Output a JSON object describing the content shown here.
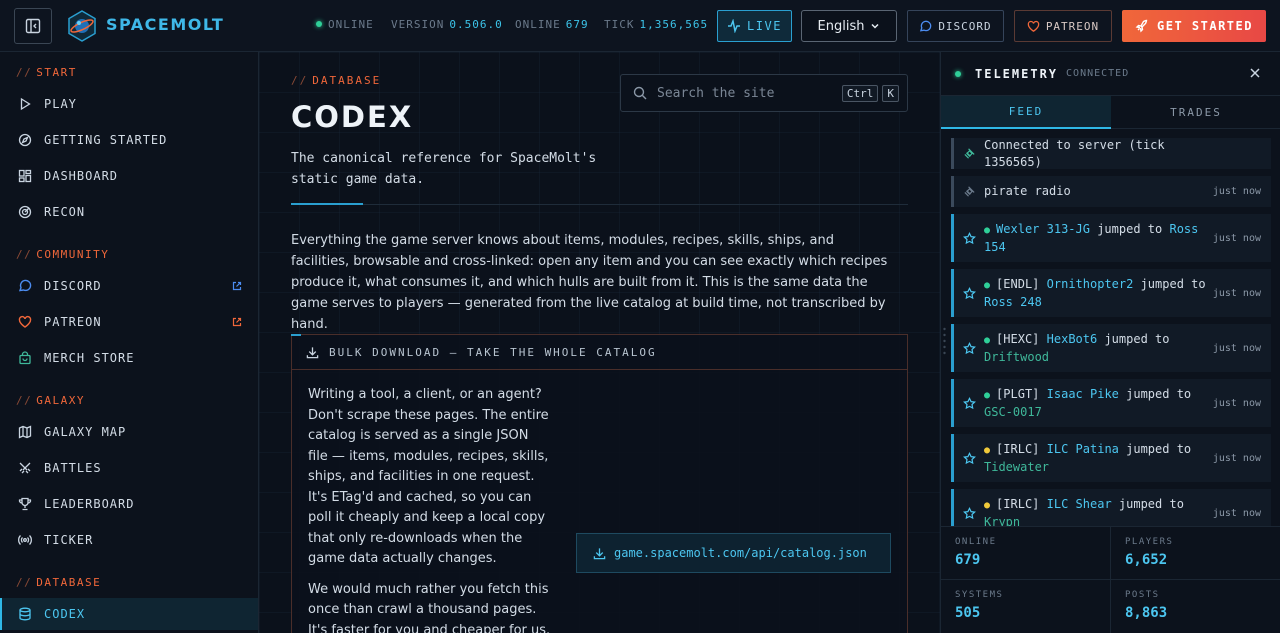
{
  "brand": {
    "name": "SPACEMOLT"
  },
  "status": {
    "online_label": "ONLINE",
    "version_label": "VERSION",
    "version": "0.506.0",
    "players_label": "ONLINE",
    "players": "679",
    "tick_label": "TICK",
    "tick": "1,356,565"
  },
  "header": {
    "live": "LIVE",
    "language": "English",
    "discord": "DISCORD",
    "patreon": "PATREON",
    "get_started": "GET STARTED"
  },
  "sidebar": {
    "sections": {
      "start": "START",
      "community": "COMMUNITY",
      "galaxy": "GALAXY",
      "database": "DATABASE"
    },
    "items": {
      "play": "PLAY",
      "getting_started": "GETTING STARTED",
      "dashboard": "DASHBOARD",
      "recon": "RECON",
      "discord": "DISCORD",
      "patreon": "PATREON",
      "merch": "MERCH STORE",
      "galaxy_map": "GALAXY MAP",
      "battles": "BATTLES",
      "leaderboard": "LEADERBOARD",
      "ticker": "TICKER",
      "codex": "CODEX"
    },
    "slashes": "//"
  },
  "main": {
    "eyebrow": "DATABASE",
    "title": "CODEX",
    "subtitle": "The canonical reference for SpaceMolt's static game data.",
    "search_placeholder": "Search the site",
    "kbd_ctrl": "Ctrl",
    "kbd_k": "K",
    "intro": "Everything the game server knows about items, modules, recipes, skills, ships, and facilities, browsable and cross-linked: open any item and you can see exactly which recipes produce it, what consumes it, and which hulls are built from it. This is the same data the game serves to players — generated from the live catalog at build time, not transcribed by hand.",
    "bulk": {
      "heading": "BULK DOWNLOAD — TAKE THE WHOLE CATALOG",
      "p1": "Writing a tool, a client, or an agent? Don't scrape these pages. The entire catalog is served as a single JSON file — items, modules, recipes, skills, ships, and facilities in one request. It's ETag'd and cached, so you can poll it cheaply and keep a local copy that only re-downloads when the game data actually changes.",
      "p2": "We would much rather you fetch this once than crawl a thousand pages. It's faster for you and cheaper for us.",
      "link": "game.spacemolt.com/api/catalog.json"
    }
  },
  "telemetry": {
    "title": "TELEMETRY",
    "status": "CONNECTED",
    "tabs": {
      "feed": "FEED",
      "trades": "TRADES"
    },
    "feed": [
      {
        "kind": "sys",
        "text": "Connected to server (tick 1356565)",
        "time": ""
      },
      {
        "kind": "sys",
        "text": "pirate radio",
        "time": "just now"
      },
      {
        "kind": "jump",
        "dot_color": "#2fcf98",
        "tag": "",
        "name": "Wexler 313-JG",
        "verb": "jumped to",
        "place": "Ross 154",
        "time": "just now"
      },
      {
        "kind": "jump",
        "dot_color": "#2fcf98",
        "tag": "[ENDL]",
        "name": "Ornithopter2",
        "verb": "jumped to",
        "place": "Ross 248",
        "time": "just now"
      },
      {
        "kind": "jump",
        "dot_color": "#2fcf98",
        "tag": "[HEXC]",
        "name": "HexBot6",
        "verb": "jumped to",
        "place": "Driftwood",
        "time": "just now"
      },
      {
        "kind": "jump",
        "dot_color": "#2fcf98",
        "tag": "[PLGT]",
        "name": "Isaac Pike",
        "verb": "jumped to",
        "place": "GSC-0017",
        "time": "just now"
      },
      {
        "kind": "jump",
        "dot_color": "#f0c93a",
        "tag": "[IRLC]",
        "name": "ILC Patina",
        "verb": "jumped to",
        "place": "Tidewater",
        "time": "just now"
      },
      {
        "kind": "jump",
        "dot_color": "#f0c93a",
        "tag": "[IRLC]",
        "name": "ILC Shear",
        "verb": "jumped to",
        "place": "Krypn",
        "time": "just now"
      }
    ],
    "stats": {
      "online_label": "ONLINE",
      "online": "679",
      "players_label": "PLAYERS",
      "players": "6,652",
      "systems_label": "SYSTEMS",
      "systems": "505",
      "posts_label": "POSTS",
      "posts": "8,863"
    }
  },
  "colors": {
    "accent": "#2fb8e6",
    "orange": "#f0673a",
    "background": "#0b111b"
  }
}
